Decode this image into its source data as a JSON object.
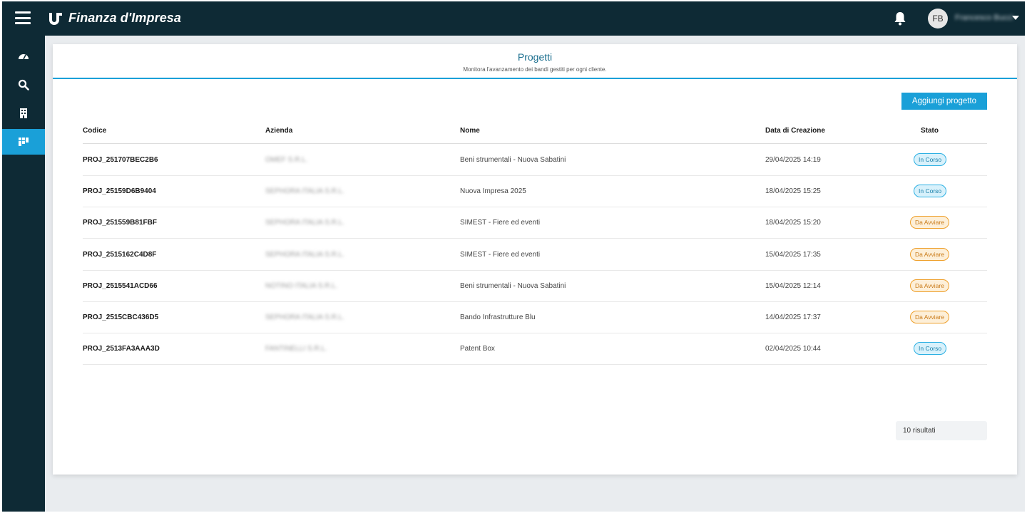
{
  "app": {
    "brand": "Finanza d'Impresa"
  },
  "user": {
    "initials": "FB",
    "name": "Francesco Bucci"
  },
  "page": {
    "title": "Progetti",
    "subtitle": "Monitora l'avanzamento dei bandi gestiti per ogni cliente.",
    "add_button": "Aggiungi progetto",
    "results_label": "10 risultati"
  },
  "sidebar": {
    "items": [
      {
        "icon": "dashboard-icon",
        "active": false
      },
      {
        "icon": "search-icon",
        "active": false
      },
      {
        "icon": "building-icon",
        "active": false
      },
      {
        "icon": "projects-icon",
        "active": true
      }
    ]
  },
  "table": {
    "headers": {
      "code": "Codice",
      "company": "Azienda",
      "name": "Nome",
      "date": "Data di Creazione",
      "status": "Stato"
    },
    "rows": [
      {
        "code": "PROJ_251707BEC2B6",
        "company": "OMEF S.R.L.",
        "name": "Beni strumentali - Nuova Sabatini",
        "date": "29/04/2025 14:19",
        "status": "In Corso"
      },
      {
        "code": "PROJ_25159D6B9404",
        "company": "SEPHORA ITALIA S.R.L.",
        "name": "Nuova Impresa 2025",
        "date": "18/04/2025 15:25",
        "status": "In Corso"
      },
      {
        "code": "PROJ_251559B81FBF",
        "company": "SEPHORA ITALIA S.R.L.",
        "name": "SIMEST - Fiere ed eventi",
        "date": "18/04/2025 15:20",
        "status": "Da Avviare"
      },
      {
        "code": "PROJ_2515162C4D8F",
        "company": "SEPHORA ITALIA S.R.L.",
        "name": "SIMEST - Fiere ed eventi",
        "date": "15/04/2025 17:35",
        "status": "Da Avviare"
      },
      {
        "code": "PROJ_2515541ACD66",
        "company": "NOTINO ITALIA S.R.L.",
        "name": "Beni strumentali - Nuova Sabatini",
        "date": "15/04/2025 12:14",
        "status": "Da Avviare"
      },
      {
        "code": "PROJ_2515CBC436D5",
        "company": "SEPHORA ITALIA S.R.L.",
        "name": "Bando Infrastrutture Blu",
        "date": "14/04/2025 17:37",
        "status": "Da Avviare"
      },
      {
        "code": "PROJ_2513FA3AAA3D",
        "company": "FANTINELLI S.R.L.",
        "name": "Patent Box",
        "date": "02/04/2025 10:44",
        "status": "In Corso"
      }
    ]
  },
  "colors": {
    "topbar": "#0e2a35",
    "accent": "#1aa0d8",
    "in_corso": "#2cb0e3",
    "da_avviare": "#ee9f2a"
  }
}
